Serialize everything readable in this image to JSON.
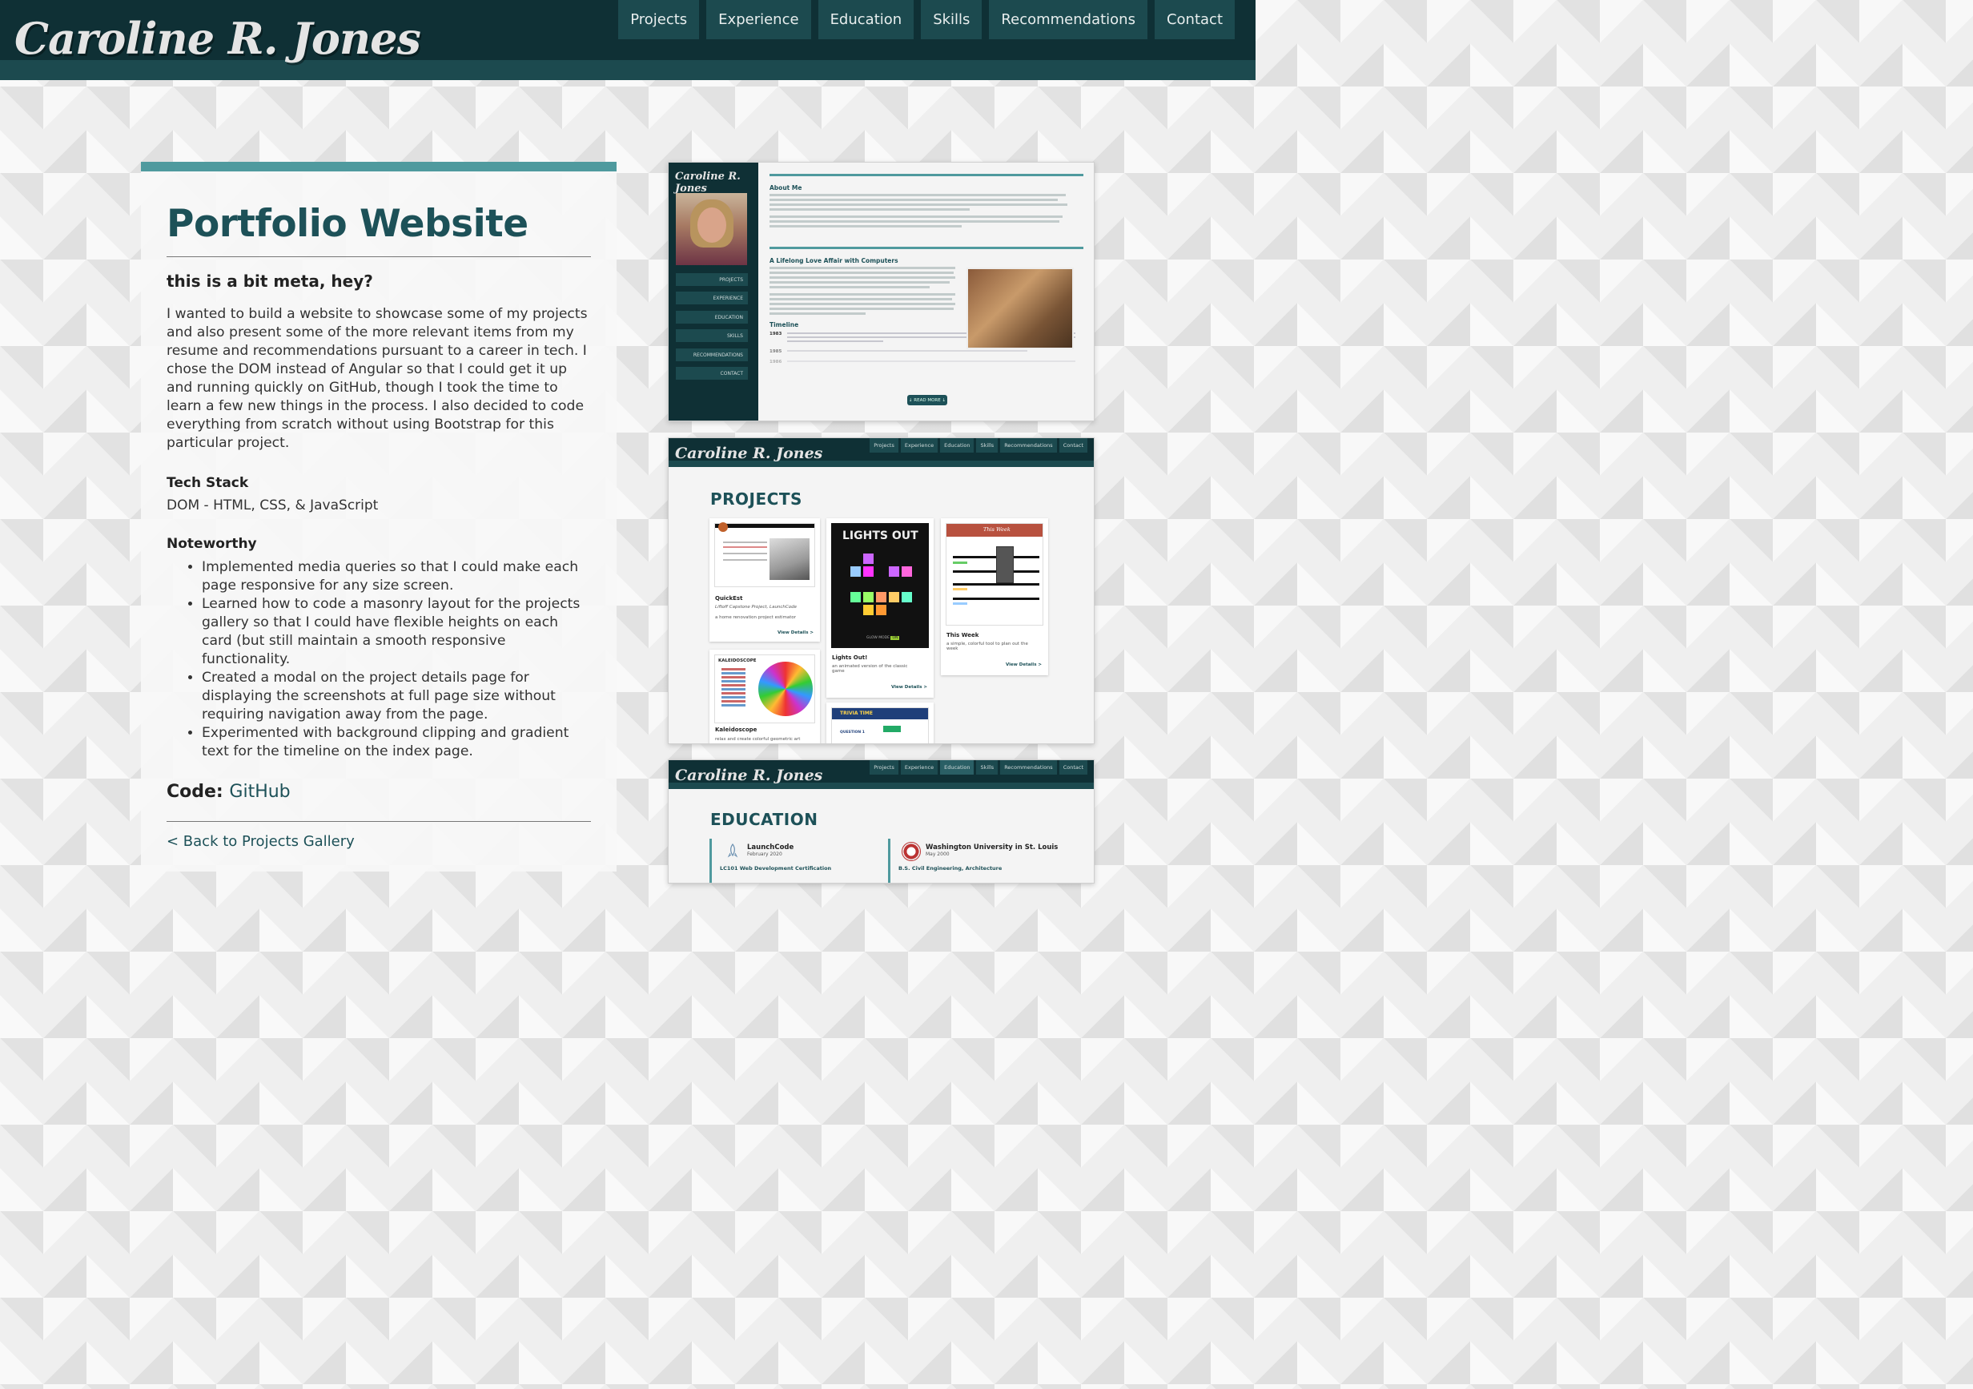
{
  "header": {
    "logo": "Caroline R. Jones",
    "nav": [
      "Projects",
      "Experience",
      "Education",
      "Skills",
      "Recommendations",
      "Contact"
    ]
  },
  "project": {
    "title": "Portfolio Website",
    "subtitle": "this is a bit meta, hey?",
    "description": "I wanted to build a website to showcase some of my projects and also present some of the more relevant items from my resume and recommendations pursuant to a career in tech. I chose the DOM instead of Angular so that I could get it up and running quickly on GitHub, though I took the time to learn a few new things in the process. I also decided to code everything from scratch without using Bootstrap for this particular project.",
    "tech_stack_label": "Tech Stack",
    "tech_stack": "DOM - HTML, CSS, & JavaScript",
    "noteworthy_label": "Noteworthy",
    "noteworthy": [
      "Implemented media queries so that I could make each page responsive for any size screen.",
      "Learned how to code a masonry layout for the projects gallery so that I could have flexible heights on each card (but still maintain a smooth responsive functionality.",
      "Created a modal on the project details page for displaying the screenshots at full page size without requiring navigation away from the page.",
      "Experimented with background clipping and gradient text for the timeline on the index page."
    ],
    "code_label": "Code:",
    "code_link": "GitHub",
    "back_link": "< Back to Projects Gallery"
  },
  "screenshots": {
    "shot1": {
      "logo": "Caroline R. Jones",
      "nav": [
        "PROJECTS",
        "EXPERIENCE",
        "EDUCATION",
        "SKILLS",
        "RECOMMENDATIONS",
        "CONTACT"
      ],
      "about_heading": "About Me",
      "love_heading": "A Lifelong Love Affair with Computers",
      "timeline_heading": "Timeline",
      "years": [
        "1983",
        "1985",
        "1986"
      ],
      "read_more": "↓ READ MORE ↓"
    },
    "shot2": {
      "logo": "Caroline R. Jones",
      "nav": [
        "Projects",
        "Experience",
        "Education",
        "Skills",
        "Recommendations",
        "Contact"
      ],
      "heading": "PROJECTS",
      "cards": [
        {
          "name": "QuickEst",
          "sub": "Liftoff Capstone Project, LaunchCode",
          "desc": "a home renovation project estimator",
          "link": "View Details >"
        },
        {
          "name": "Lights Out!",
          "thumb_title": "LIGHTS OUT",
          "desc": "an animated version of the classic game",
          "link": "View Details >",
          "glow": "GLOW MODE",
          "glow_state": "ON"
        },
        {
          "name": "This Week",
          "thumb_title": "This Week",
          "desc": "a simple, colorful tool to plan out the week",
          "link": "View Details >"
        },
        {
          "name": "Kaleidoscope",
          "thumb_title": "KALEIDOSCOPE",
          "desc": "relax and create colorful geometric art"
        },
        {
          "thumb_title": "TRIVIA TIME",
          "thumb_sub": "QUESTION 1"
        }
      ]
    },
    "shot3": {
      "logo": "Caroline R. Jones",
      "nav": [
        "Projects",
        "Experience",
        "Education",
        "Skills",
        "Recommendations",
        "Contact"
      ],
      "heading": "EDUCATION",
      "schools": [
        {
          "name": "LaunchCode",
          "date": "February 2020",
          "cert": "LC101 Web Development Certification"
        },
        {
          "name": "Washington University in St. Louis",
          "date": "May 2000",
          "cert": "B.S. Civil Engineering, Architecture"
        }
      ]
    }
  },
  "colors": {
    "header_dark": "#0f3035",
    "header_band": "#1c4a4f",
    "accent_teal": "#4f9a9e",
    "title_teal": "#1d5158"
  }
}
